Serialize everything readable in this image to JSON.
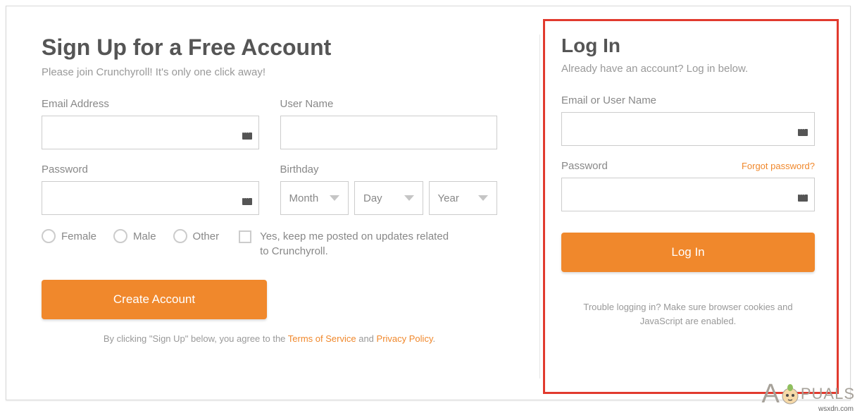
{
  "signup": {
    "title": "Sign Up for a Free Account",
    "subtitle": "Please join Crunchyroll! It's only one click away!",
    "email_label": "Email Address",
    "username_label": "User Name",
    "password_label": "Password",
    "birthday_label": "Birthday",
    "month": "Month",
    "day": "Day",
    "year": "Year",
    "gender": {
      "female": "Female",
      "male": "Male",
      "other": "Other"
    },
    "newsletter_label": "Yes, keep me posted on updates related to Crunchyroll.",
    "create_button": "Create Account",
    "legal_prefix": "By clicking \"Sign Up\" below, you agree to the ",
    "tos": "Terms of Service",
    "and": " and ",
    "privacy": "Privacy Policy",
    "period": "."
  },
  "login": {
    "title": "Log In",
    "subtitle": "Already have an account? Log in below.",
    "username_label": "Email or User Name",
    "password_label": "Password",
    "forgot": "Forgot password?",
    "button": "Log In",
    "trouble": "Trouble logging in? Make sure browser cookies and JavaScript are enabled."
  },
  "watermark": {
    "brand_prefix": "A",
    "brand_rest": "PUALS",
    "source": "wsxdn.com"
  }
}
